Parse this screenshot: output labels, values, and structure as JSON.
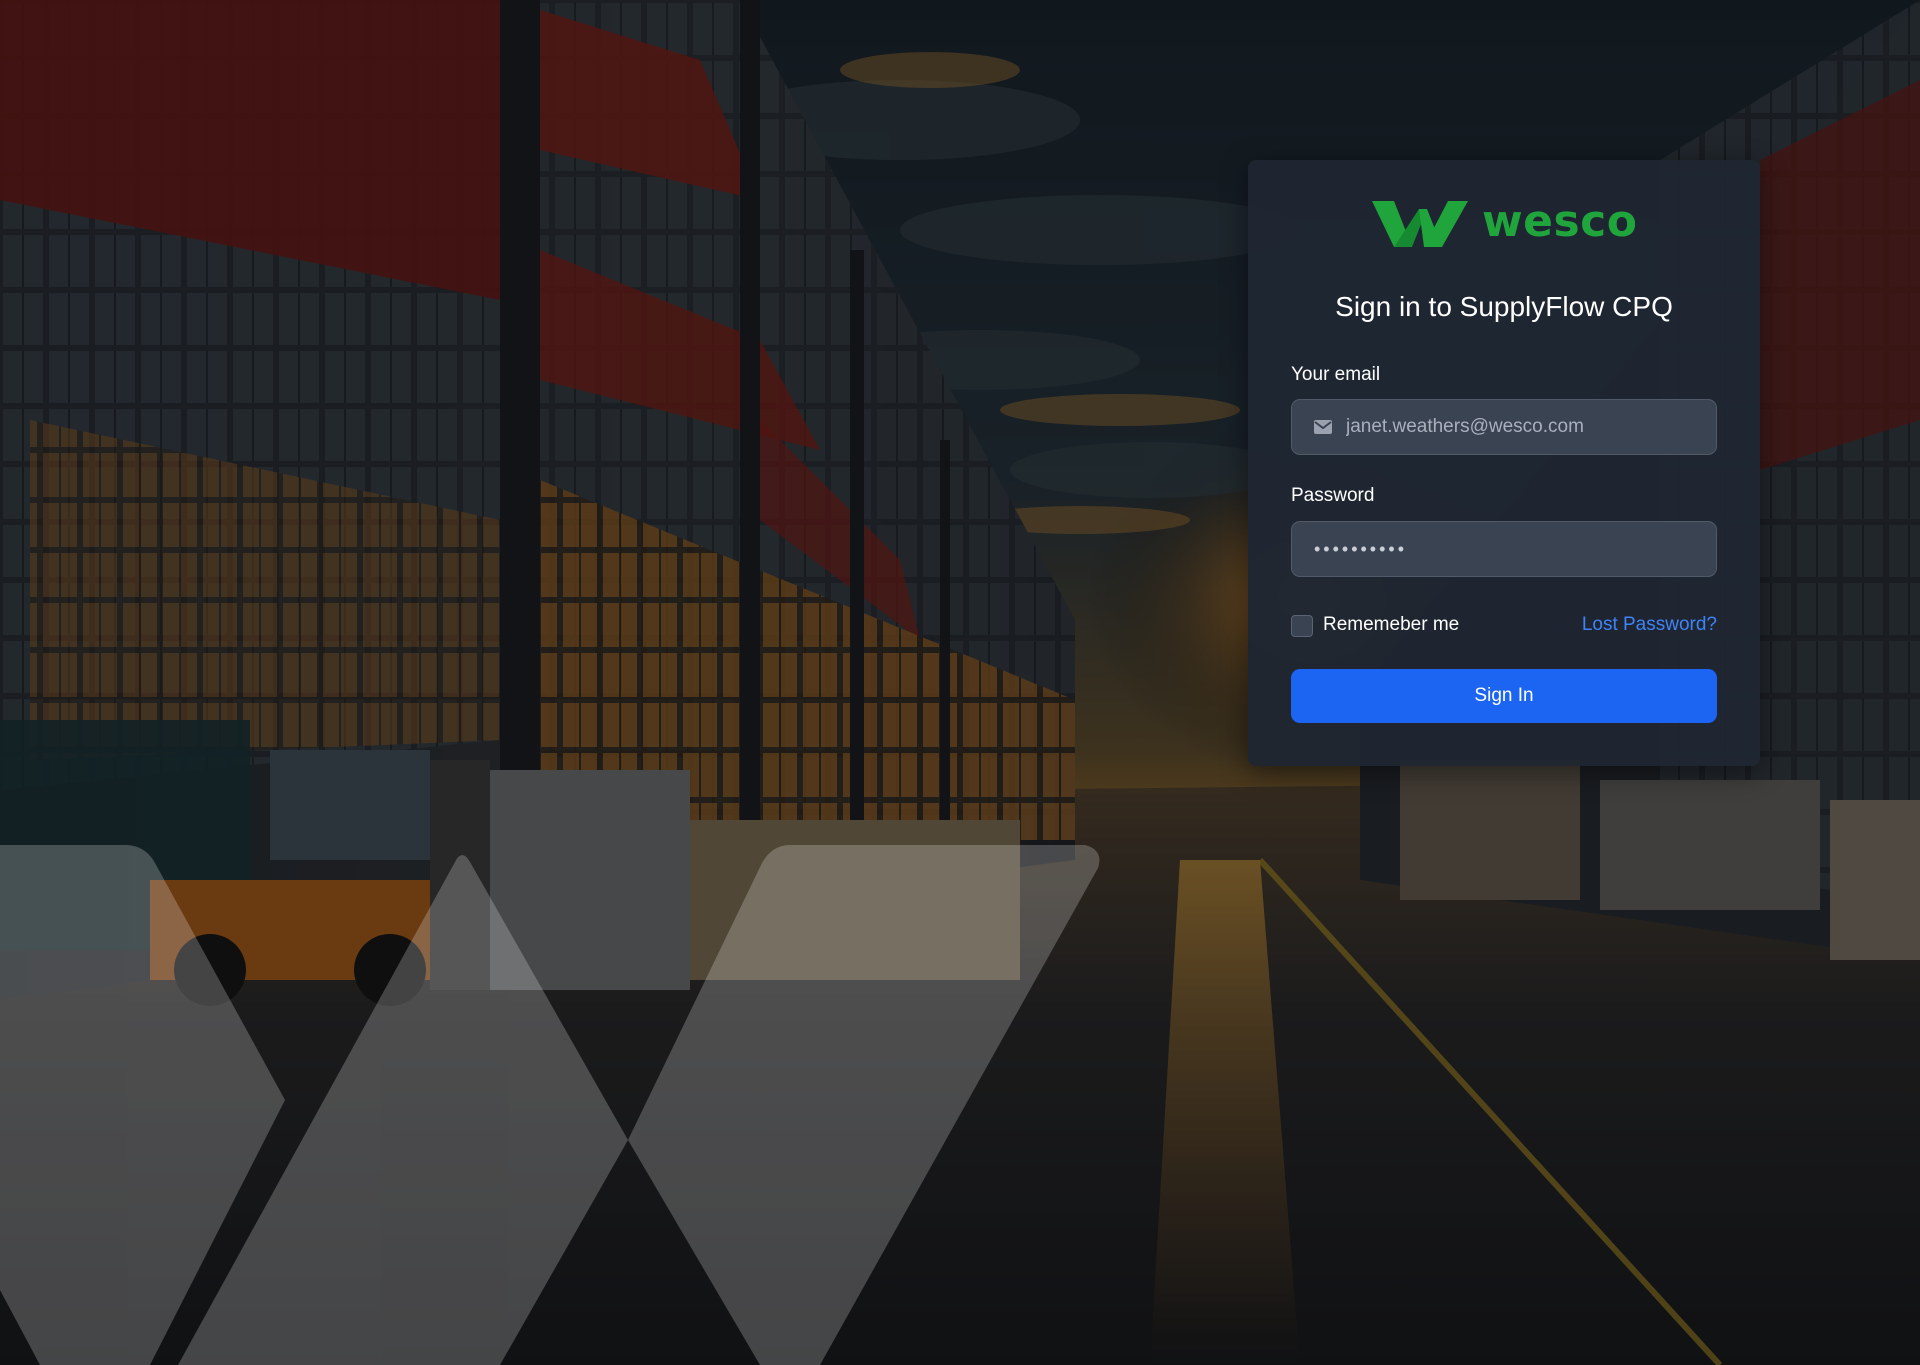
{
  "brand": {
    "name": "wesco",
    "logo_icon": "wesco-w-mark-icon",
    "color": "#1fa53b"
  },
  "form": {
    "title": "Sign in to SupplyFlow CPQ",
    "email_label": "Your email",
    "email_value": "janet.weathers@wesco.com",
    "email_icon": "mail-icon",
    "password_label": "Password",
    "password_value": "••••••••••",
    "remember_label": "Rememeber me",
    "remember_checked": false,
    "lost_password": "Lost Password?",
    "submit_label": "Sign In"
  },
  "colors": {
    "card_bg": "#1f2632",
    "input_bg": "#3a4352",
    "primary_button": "#1c64f2",
    "link": "#3f83f8"
  }
}
